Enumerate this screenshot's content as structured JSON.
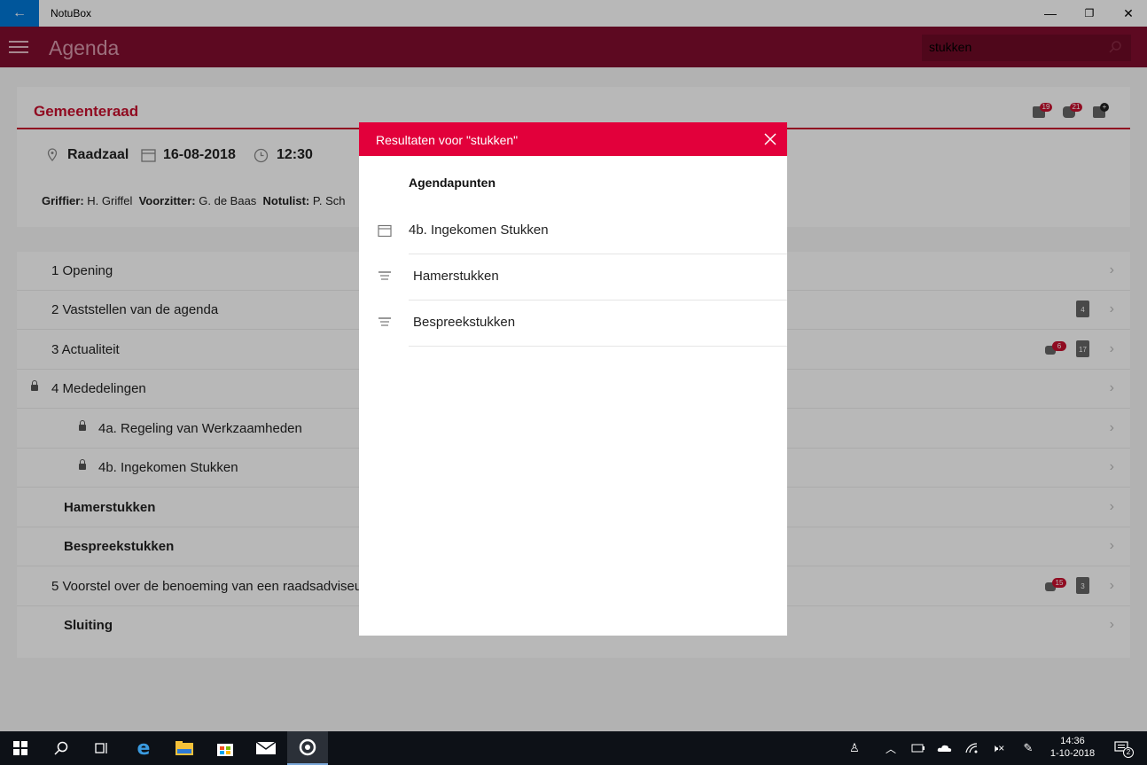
{
  "window": {
    "title": "NotuBox",
    "minimize": "—",
    "restore": "❐",
    "close": "✕"
  },
  "header": {
    "title": "Agenda",
    "search_value": "stukken"
  },
  "meeting": {
    "name": "Gemeenteraad",
    "badges": {
      "downloads": "19",
      "comments": "21"
    },
    "location": "Raadzaal",
    "date": "16-08-2018",
    "time": "12:30",
    "roles": [
      {
        "label": "Griffier:",
        "value": "H. Griffel"
      },
      {
        "label": "Voorzitter:",
        "value": "G. de Baas"
      },
      {
        "label": "Notulist:",
        "value": "P. Sch"
      }
    ]
  },
  "agenda": [
    {
      "label": "1 Opening",
      "indent": 0,
      "bold": false,
      "lock": false
    },
    {
      "label": "2 Vaststellen van de agenda",
      "indent": 0,
      "bold": false,
      "lock": false,
      "docs": "4"
    },
    {
      "label": "3 Actualiteit",
      "indent": 0,
      "bold": false,
      "lock": false,
      "comments": "6",
      "docs": "17"
    },
    {
      "label": "4 Mededelingen",
      "indent": 0,
      "bold": false,
      "lock": true
    },
    {
      "label": "4a. Regeling van Werkzaamheden",
      "indent": 1,
      "bold": false,
      "lock": true
    },
    {
      "label": "4b. Ingekomen Stukken",
      "indent": 1,
      "bold": false,
      "lock": true
    },
    {
      "label": "Hamerstukken",
      "indent": 0,
      "bold": true,
      "lock": false
    },
    {
      "label": "Bespreekstukken",
      "indent": 0,
      "bold": true,
      "lock": false
    },
    {
      "label": "5 Voorstel over de benoeming van een raadsadviseu",
      "indent": 0,
      "bold": false,
      "lock": false,
      "comments": "15",
      "docs": "3"
    },
    {
      "label": "Sluiting",
      "indent": 0,
      "bold": true,
      "lock": false
    }
  ],
  "modal": {
    "title": "Resultaten voor \"stukken\"",
    "section": "Agendapunten",
    "results": [
      {
        "label": "4b. Ingekomen Stukken",
        "icon": "calendar-icon"
      },
      {
        "label": "Hamerstukken",
        "icon": "list-icon"
      },
      {
        "label": "Bespreekstukken",
        "icon": "list-icon"
      }
    ]
  },
  "taskbar": {
    "time": "14:36",
    "date": "1-10-2018",
    "notifications": "2"
  },
  "colors": {
    "accent": "#e2003b",
    "header": "#c8102e"
  }
}
